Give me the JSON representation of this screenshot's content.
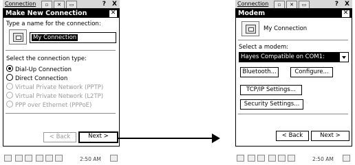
{
  "left_screen": {
    "background_window": {
      "title": "Connection",
      "help_glyph": "?",
      "close_glyph": "X"
    },
    "dialog": {
      "title": "Make New Connection",
      "close_glyph": "✕",
      "name_prompt": "Type a name for the connection:",
      "connection_name": "My Connection",
      "type_prompt": "Select the connection type:",
      "connection_types": [
        {
          "label": "Dial-Up Connection",
          "selected": true,
          "enabled": true
        },
        {
          "label": "Direct Connection",
          "selected": false,
          "enabled": true
        },
        {
          "label": "Virtual Private Network (PPTP)",
          "selected": false,
          "enabled": false
        },
        {
          "label": "Virtual Private Network (L2TP)",
          "selected": false,
          "enabled": false
        },
        {
          "label": "PPP over Ethernet (PPPoE)",
          "selected": false,
          "enabled": false
        }
      ],
      "back_label": "< Back",
      "next_label": "Next >"
    },
    "taskbar": {
      "clock": "2:50 AM"
    }
  },
  "right_screen": {
    "background_window": {
      "title": "Connection",
      "help_glyph": "?",
      "close_glyph": "X"
    },
    "dialog": {
      "title": "Modem",
      "close_glyph": "✕",
      "connection_name": "My Connection",
      "modem_prompt": "Select a modem:",
      "modem_selected": "Hayes Compatible on COM1:",
      "bluetooth_label": "Bluetooth...",
      "configure_label": "Configure...",
      "tcpip_label": "TCP/IP Settings...",
      "security_label": "Security Settings...",
      "back_label": "< Back",
      "next_label": "Next >"
    },
    "taskbar": {
      "clock": "2:50 AM"
    }
  },
  "icons": {
    "connection_icon": "network-connection-icon",
    "arrow": "right-arrow"
  }
}
